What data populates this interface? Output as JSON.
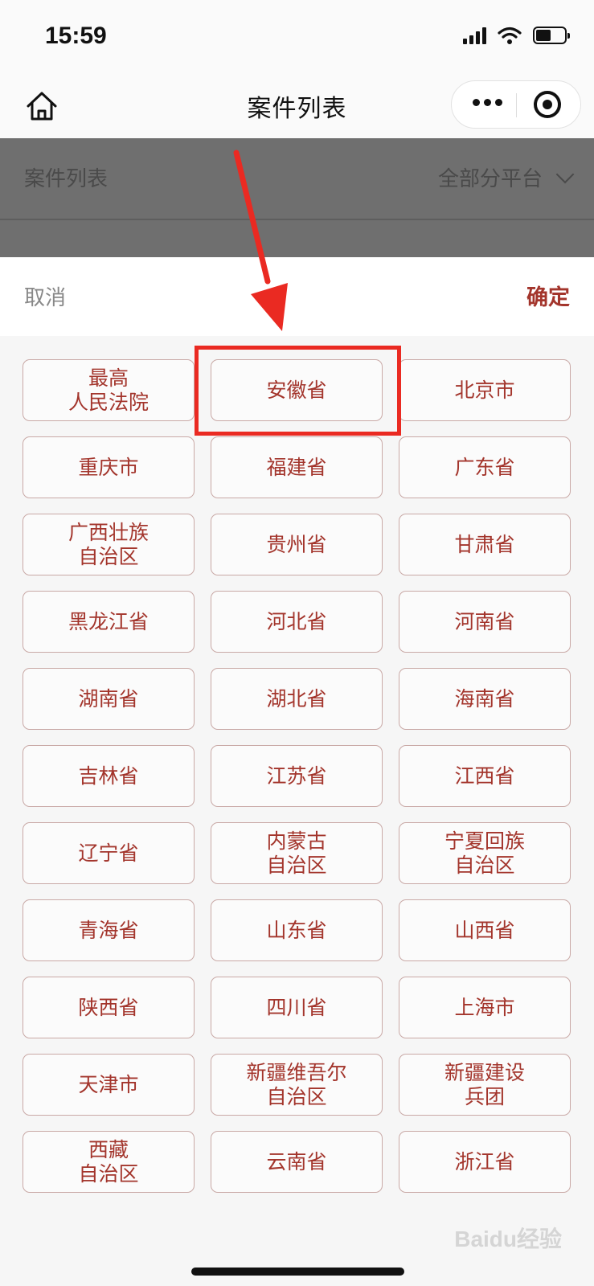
{
  "status_bar": {
    "time": "15:59"
  },
  "nav": {
    "title": "案件列表"
  },
  "filter_bar": {
    "title": "案件列表",
    "filter_value": "全部分平台"
  },
  "sheet": {
    "cancel_label": "取消",
    "confirm_label": "确定"
  },
  "regions": [
    "最高\n人民法院",
    "安徽省",
    "北京市",
    "重庆市",
    "福建省",
    "广东省",
    "广西壮族\n自治区",
    "贵州省",
    "甘肃省",
    "黑龙江省",
    "河北省",
    "河南省",
    "湖南省",
    "湖北省",
    "海南省",
    "吉林省",
    "江苏省",
    "江西省",
    "辽宁省",
    "内蒙古\n自治区",
    "宁夏回族\n自治区",
    "青海省",
    "山东省",
    "山西省",
    "陕西省",
    "四川省",
    "上海市",
    "天津市",
    "新疆维吾尔\n自治区",
    "新疆建设\n兵团",
    "西藏\n自治区",
    "云南省",
    "浙江省"
  ],
  "annotation": {
    "highlighted_item": "安徽省",
    "color": "#ea2a22"
  },
  "colors": {
    "accent": "#a3352c",
    "overlay": "#6f6f6f"
  },
  "watermark": "Baidu经验"
}
